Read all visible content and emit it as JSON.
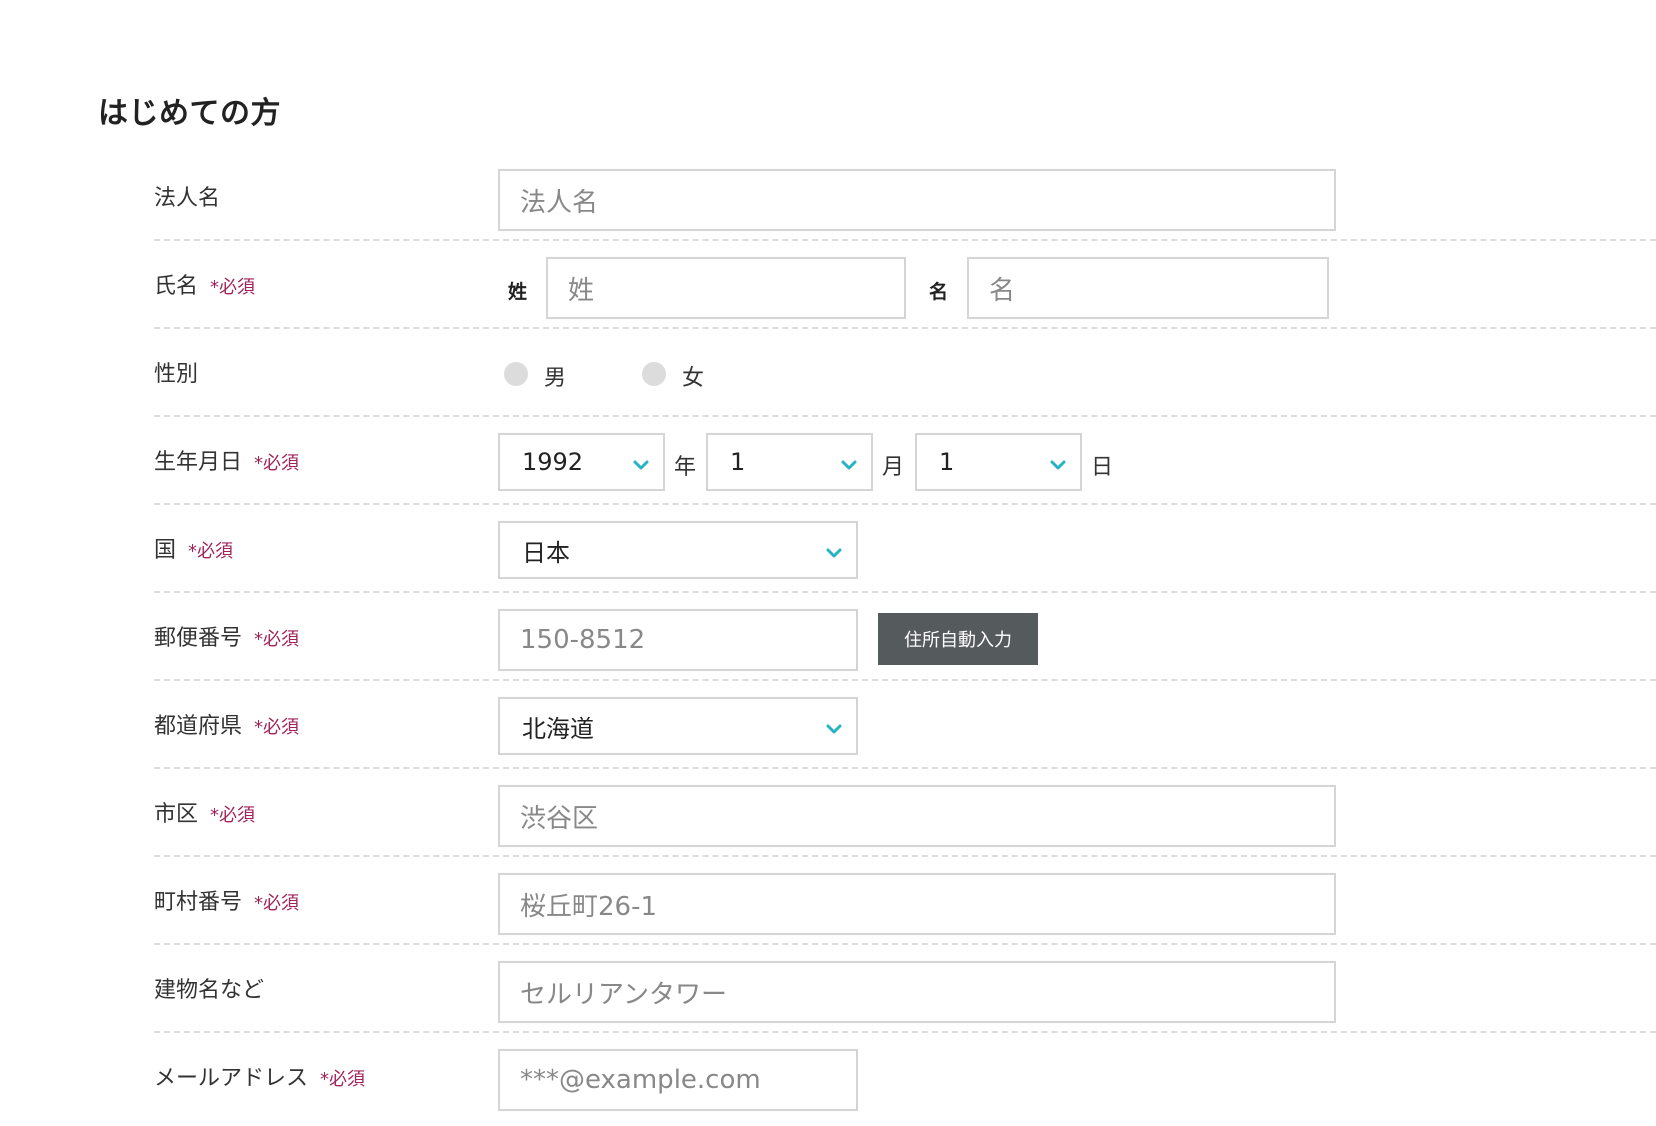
{
  "title": "はじめての方",
  "required_mark": "*必須",
  "corp": {
    "label": "法人名",
    "placeholder": "法人名"
  },
  "name": {
    "label": "氏名",
    "last_label": "姓",
    "last_placeholder": "姓",
    "first_label": "名",
    "first_placeholder": "名"
  },
  "gender": {
    "label": "性別",
    "options": [
      "男",
      "女"
    ]
  },
  "birthday": {
    "label": "生年月日",
    "year": "1992",
    "year_unit": "年",
    "month": "1",
    "month_unit": "月",
    "day": "1",
    "day_unit": "日"
  },
  "country": {
    "label": "国",
    "value": "日本"
  },
  "postal": {
    "label": "郵便番号",
    "placeholder": "150-8512",
    "button": "住所自動入力"
  },
  "prefecture": {
    "label": "都道府県",
    "value": "北海道"
  },
  "city": {
    "label": "市区",
    "placeholder": "渋谷区"
  },
  "town": {
    "label": "町村番号",
    "placeholder": "桜丘町26-1"
  },
  "building": {
    "label": "建物名など",
    "placeholder": "セルリアンタワー"
  },
  "email": {
    "label": "メールアドレス",
    "placeholder": "***@example.com"
  },
  "colors": {
    "accent": "#25b3c8",
    "required": "#a0245a",
    "button": "#555a5c"
  }
}
